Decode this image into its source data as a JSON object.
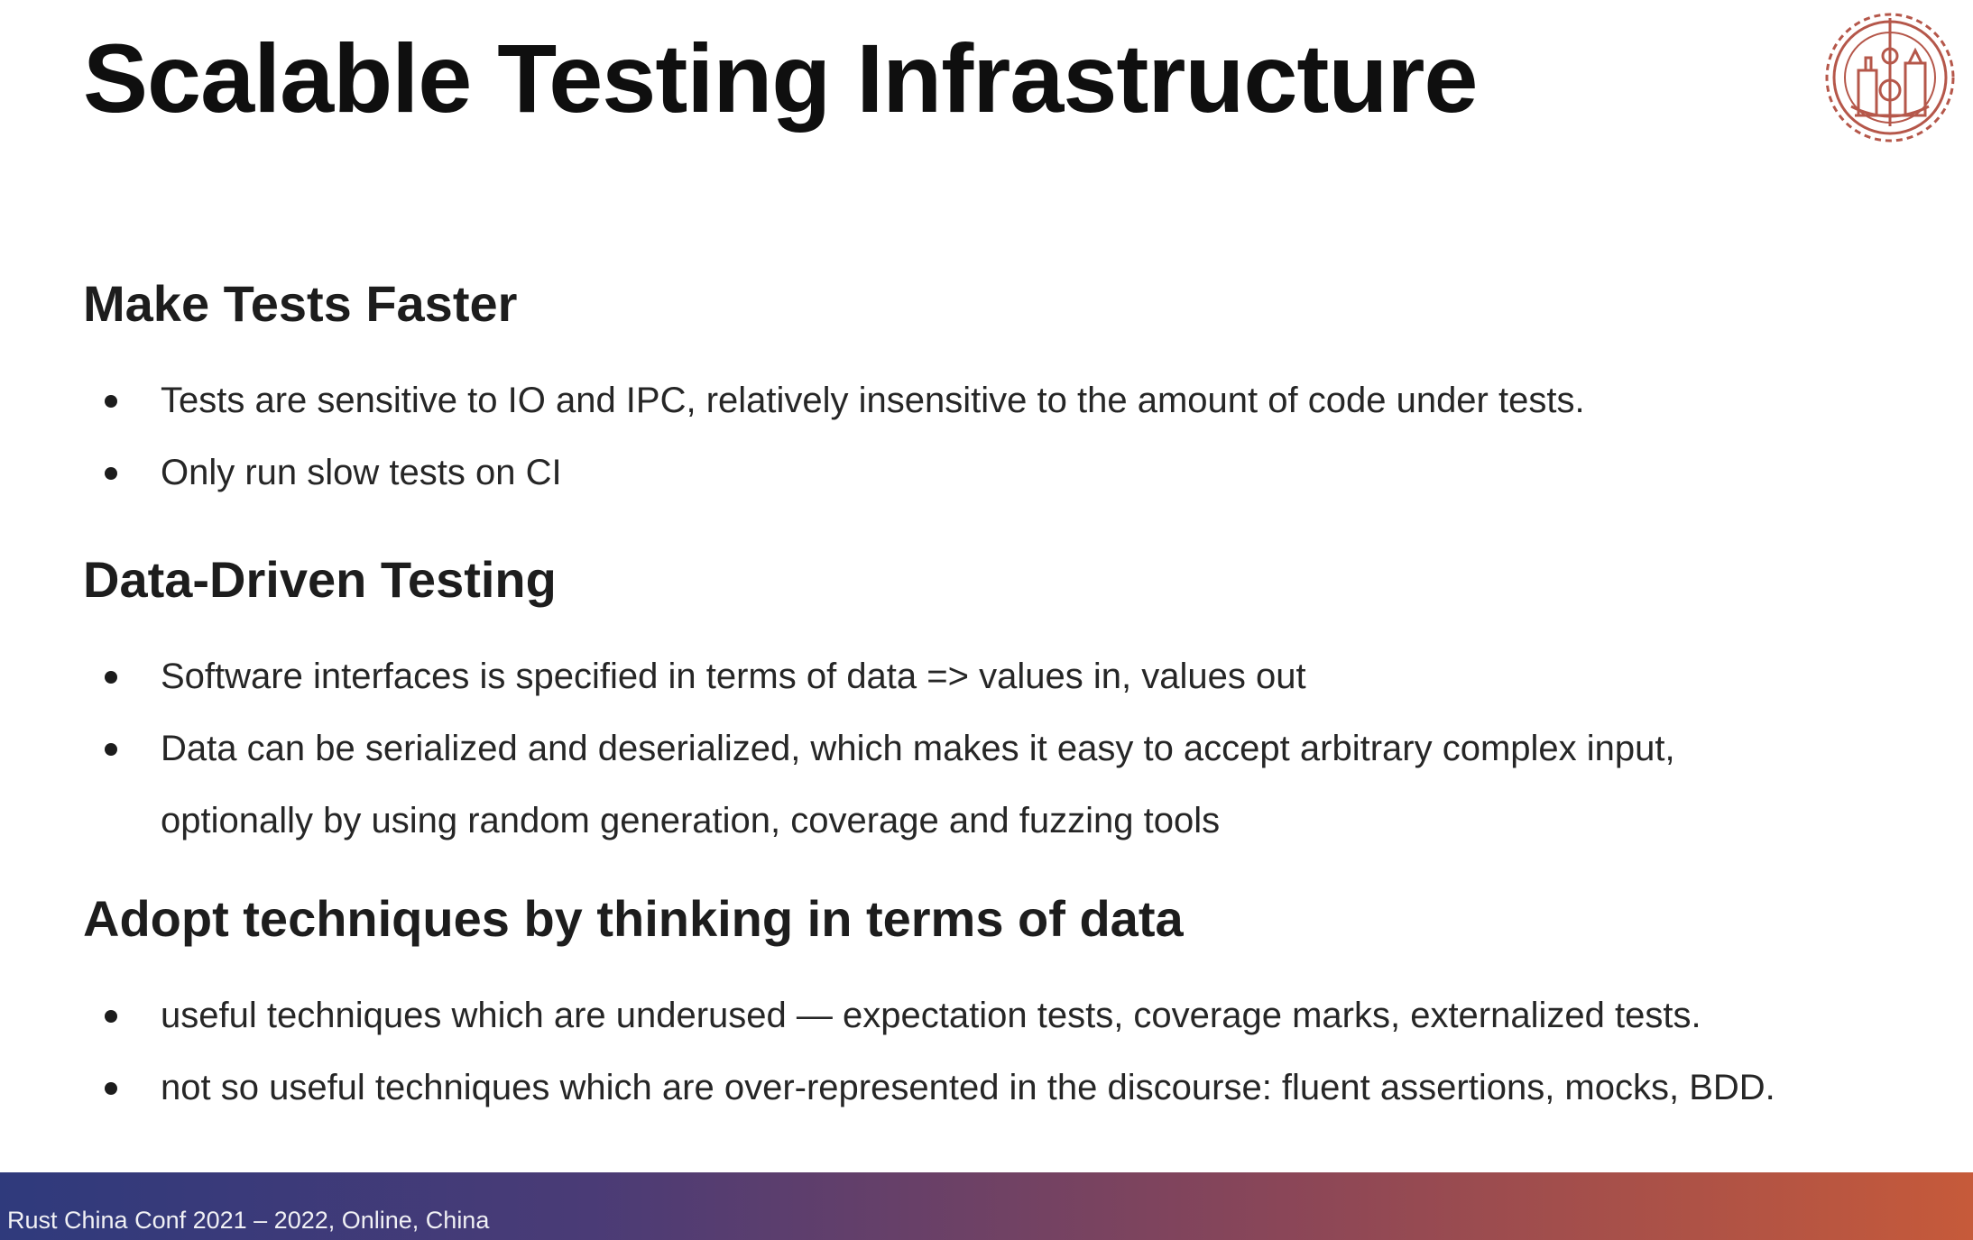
{
  "slide": {
    "title": "Scalable Testing Infrastructure",
    "logo_icon": "conference-gear-skyline-logo",
    "sections": [
      {
        "heading": "Make Tests Faster",
        "bullets": [
          "Tests are sensitive to IO and IPC, relatively insensitive to the amount of code under tests.",
          "Only run slow tests on CI"
        ]
      },
      {
        "heading": "Data-Driven Testing",
        "bullets": [
          "Software interfaces is specified in terms of data => values in, values out",
          "Data can be serialized and deserialized, which makes it easy to accept arbitrary complex input, optionally by using random generation, coverage and fuzzing tools"
        ]
      },
      {
        "heading": "Adopt techniques by thinking in terms of data",
        "bullets": [
          "useful techniques which are underused — expectation tests, coverage marks, externalized tests.",
          "not so useful techniques which are over-represented in the discourse: fluent assertions, mocks, BDD."
        ]
      }
    ]
  },
  "footer": {
    "text": "Rust China Conf 2021 – 2022, Online, China",
    "gradient_start": "#2f3a7c",
    "gradient_end": "#c65a3a"
  }
}
